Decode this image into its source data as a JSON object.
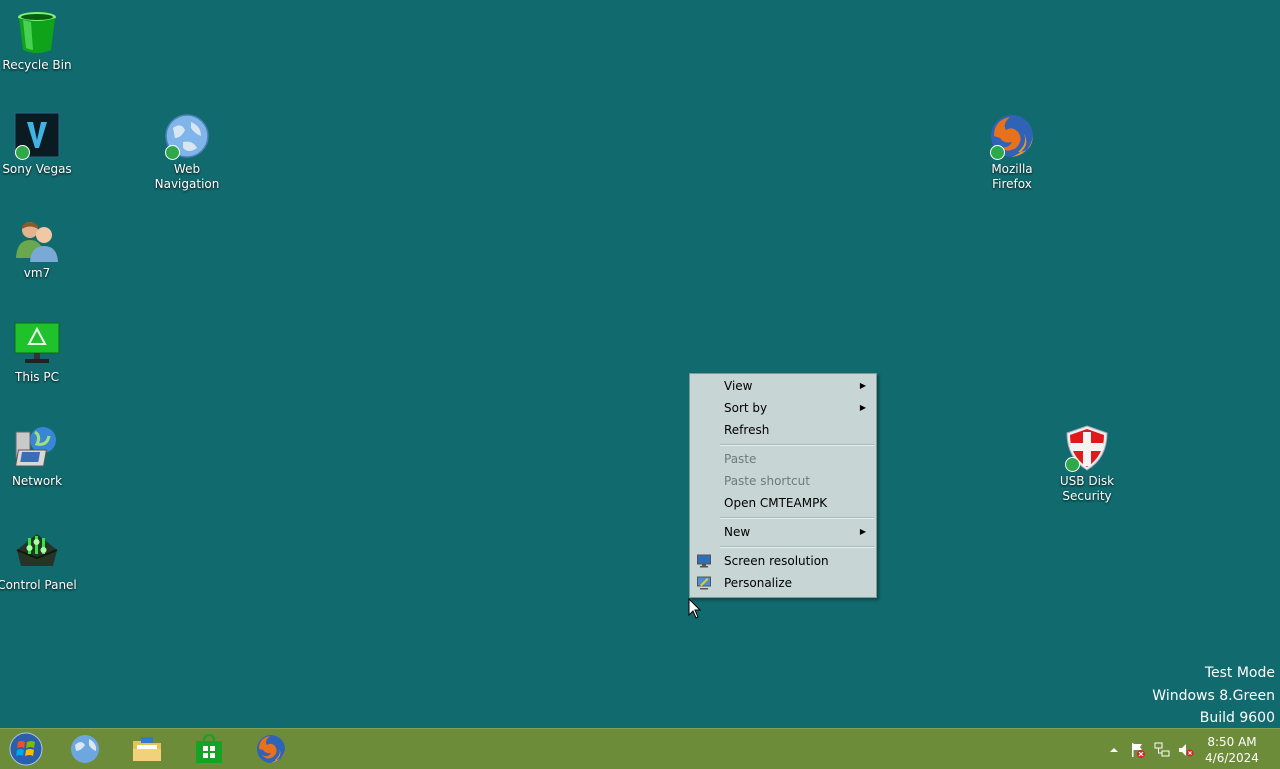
{
  "desktop": {
    "icons": [
      {
        "label": "Recycle Bin"
      },
      {
        "label": "Sony Vegas"
      },
      {
        "label": "Web Navigation"
      },
      {
        "label": "vm7"
      },
      {
        "label": "This PC"
      },
      {
        "label": "Network"
      },
      {
        "label": "Control Panel"
      },
      {
        "label": "Mozilla Firefox"
      },
      {
        "label": "USB Disk Security"
      }
    ]
  },
  "context_menu": {
    "items": [
      {
        "label": "View",
        "has_submenu": true,
        "enabled": true
      },
      {
        "label": "Sort by",
        "has_submenu": true,
        "enabled": true
      },
      {
        "label": "Refresh",
        "has_submenu": false,
        "enabled": true
      },
      {
        "label": "Paste",
        "has_submenu": false,
        "enabled": false
      },
      {
        "label": "Paste shortcut",
        "has_submenu": false,
        "enabled": false
      },
      {
        "label": "Open CMTEAMPK",
        "has_submenu": false,
        "enabled": true
      },
      {
        "label": "New",
        "has_submenu": true,
        "enabled": true
      },
      {
        "label": "Screen resolution",
        "has_submenu": false,
        "enabled": true,
        "icon": "monitor-icon"
      },
      {
        "label": "Personalize",
        "has_submenu": false,
        "enabled": true,
        "icon": "personalize-icon"
      }
    ]
  },
  "watermark": {
    "line1": "Test Mode",
    "line2": "Windows 8.Green",
    "line3": "Build 9600"
  },
  "taskbar": {
    "pinned": [
      "start-orb-icon",
      "internet-explorer-icon",
      "file-explorer-icon",
      "store-icon",
      "firefox-icon"
    ],
    "tray_icons": [
      "show-hidden-icons-icon",
      "action-center-flag-icon",
      "network-icon",
      "volume-muted-icon"
    ],
    "clock": {
      "time": "8:50 AM",
      "date": "4/6/2024"
    }
  },
  "colors": {
    "desktop": "#116a6e",
    "taskbar": "#6c8c3a",
    "menu_background": "#c7d5d5"
  }
}
